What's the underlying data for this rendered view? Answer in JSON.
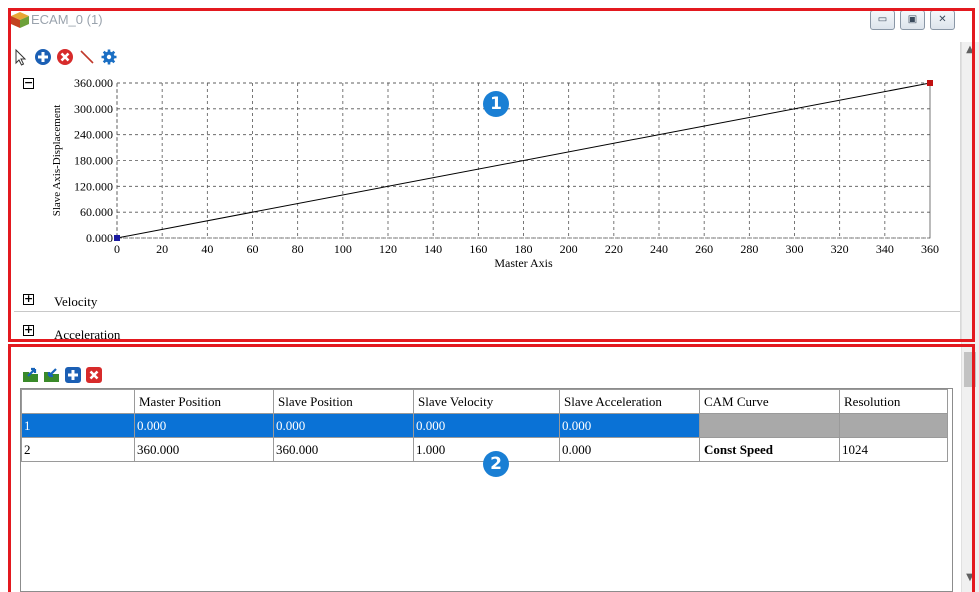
{
  "window": {
    "title": "ECAM_0 (1)",
    "minimize_glyph": "▭",
    "restore_glyph": "▣",
    "close_glyph": "✕"
  },
  "toolbar1": {
    "icons": [
      "pointer-icon",
      "add-point-icon",
      "delete-point-icon",
      "draw-line-icon",
      "settings-gear-icon"
    ]
  },
  "position_chart": {
    "collapse_glyph": "−"
  },
  "chart_data": {
    "type": "line",
    "xlabel": "Master Axis",
    "ylabel": "Slave Axis-Displacement",
    "x_ticks": [
      "0",
      "20",
      "40",
      "60",
      "80",
      "100",
      "120",
      "140",
      "160",
      "180",
      "200",
      "220",
      "240",
      "260",
      "280",
      "300",
      "320",
      "340",
      "360"
    ],
    "y_ticks": [
      "0.000",
      "60.000",
      "120.000",
      "180.000",
      "240.000",
      "300.000",
      "360.000"
    ],
    "xlim": [
      0,
      360
    ],
    "ylim": [
      0,
      360
    ],
    "grid": true,
    "series": [
      {
        "values": [
          [
            0,
            0
          ],
          [
            360,
            360
          ]
        ],
        "color": "#000000"
      }
    ],
    "start_marker_color": "#1a1aa0",
    "end_marker_color": "#c01010"
  },
  "sections": {
    "velocity_label": "Velocity",
    "acceleration_label": "Acceleration",
    "expand_glyph": "+"
  },
  "toolbar2": {
    "icons": [
      "import-icon",
      "export-icon",
      "add-row-icon",
      "delete-row-icon"
    ]
  },
  "table": {
    "headers": [
      "",
      "Master Position",
      "Slave Position",
      "Slave Velocity",
      "Slave Acceleration",
      "CAM Curve",
      "Resolution"
    ],
    "rows": [
      [
        "1",
        "0.000",
        "0.000",
        "0.000",
        "0.000",
        "",
        ""
      ],
      [
        "2",
        "360.000",
        "360.000",
        "1.000",
        "0.000",
        "Const Speed",
        "1024"
      ]
    ]
  },
  "badges": {
    "one": "1",
    "two": "2"
  },
  "colors": {
    "highlight_red": "#e3191f",
    "selection_blue": "#0a72d6",
    "badge_blue": "#1a7fd4"
  }
}
